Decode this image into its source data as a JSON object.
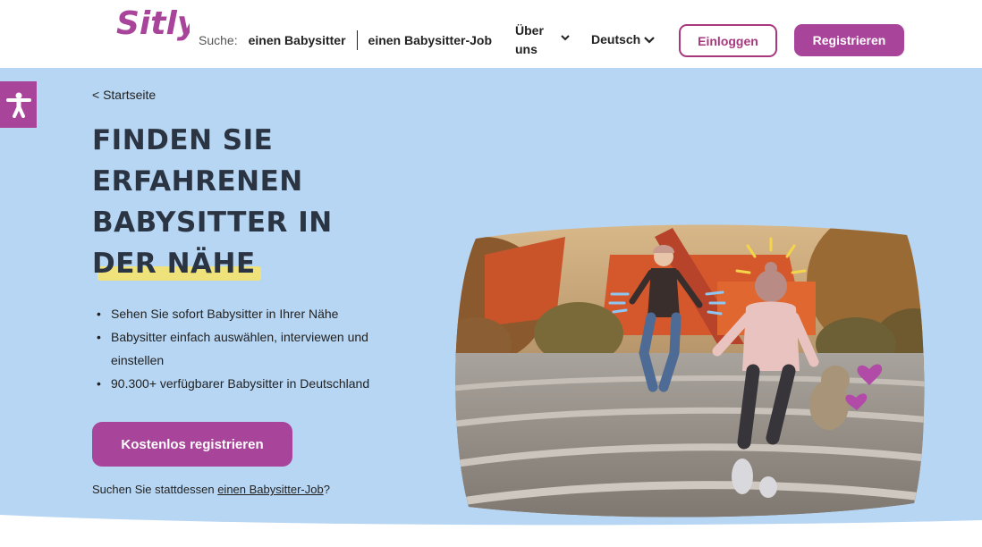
{
  "header": {
    "logo_text": "Sitly",
    "search_label": "Suche:",
    "nav_babysitter": "einen Babysitter",
    "nav_job": "einen Babysitter-Job",
    "about_line1": "Über",
    "about_line2": "uns",
    "language": "Deutsch",
    "login_label": "Einloggen",
    "register_label": "Registrieren"
  },
  "hero": {
    "breadcrumb": "< Startseite",
    "headline_lines": [
      "FINDEN SIE",
      "ERFAHRENEN",
      "BABYSITTER IN"
    ],
    "headline_highlight": "DER NÄHE",
    "bullets": [
      "Sehen Sie sofort Babysitter in Ihrer Nähe",
      "Babysitter einfach auswählen, interviewen und einstellen",
      "90.300+ verfügbarer Babysitter in Deutschland"
    ],
    "cta_label": "Kostenlos registrieren",
    "alt_prefix": "Suchen Sie stattdessen ",
    "alt_link": "einen Babysitter-Job",
    "alt_suffix": "?"
  },
  "colors": {
    "brand": "#a8449a",
    "hero_bg": "#b7d6f3",
    "highlight": "#f0e27a",
    "heading": "#2a3442"
  },
  "icons": {
    "accessibility": "accessibility-icon",
    "chevron": "chevron-down-icon"
  }
}
